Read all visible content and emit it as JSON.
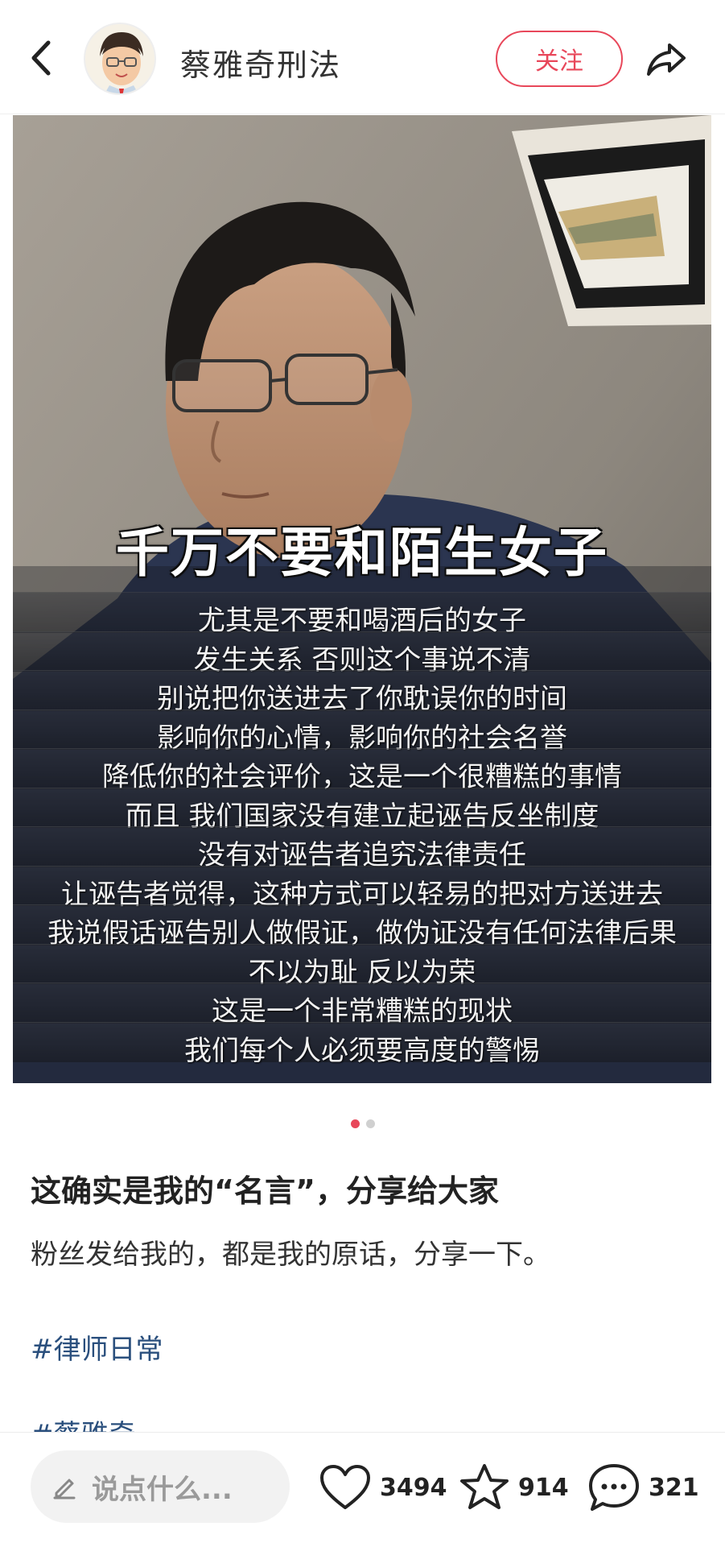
{
  "header": {
    "back_icon": "chevron-left-icon",
    "author_name": "蔡雅奇刑法",
    "follow_label": "关注",
    "share_icon": "share-arrow-icon"
  },
  "media": {
    "headline": "千万不要和陌生女子",
    "subtitle_lines": [
      "尤其是不要和喝酒后的女子",
      "发生关系 否则这个事说不清",
      "别说把你送进去了你耽误你的时间",
      "影响你的心情，影响你的社会名誉",
      "降低你的社会评价，这是一个很糟糕的事情",
      "而且 我们国家没有建立起诬告反坐制度",
      "没有对诬告者追究法律责任",
      "让诬告者觉得，这种方式可以轻易的把对方送进去",
      "我说假话诬告别人做假证，做伪证没有任何法律后果",
      "不以为耻 反以为荣",
      "这是一个非常糟糕的现状",
      "我们每个人必须要高度的警惕"
    ],
    "page_count": 2,
    "active_page": 1
  },
  "post": {
    "title": "这确实是我的“名言”，分享给大家",
    "body": "粉丝发给我的，都是我的原话，分享一下。",
    "tags": [
      "#律师日常",
      "#蔡雅奇"
    ]
  },
  "bottom_bar": {
    "comment_placeholder": "说点什么...",
    "likes": "3494",
    "favorites": "914",
    "comments": "321"
  },
  "colors": {
    "accent": "#e8475a",
    "tag": "#2a4f7d"
  }
}
